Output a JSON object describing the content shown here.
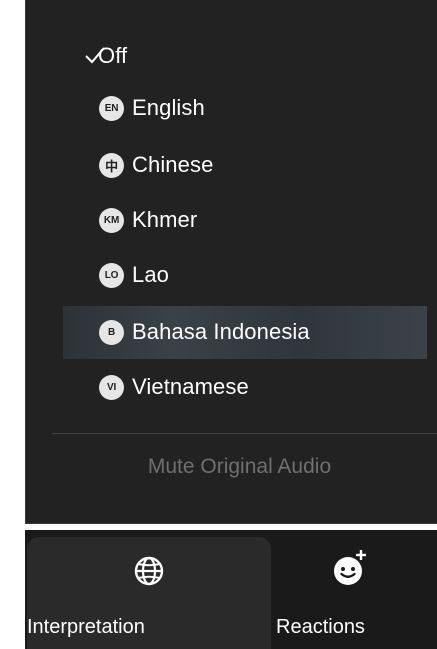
{
  "menu": {
    "selected_check": "✓",
    "items": [
      {
        "label": "Off",
        "badge": ""
      },
      {
        "label": "English",
        "badge": "EN"
      },
      {
        "label": "Chinese",
        "badge": "中"
      },
      {
        "label": "Khmer",
        "badge": "KM"
      },
      {
        "label": "Lao",
        "badge": "LO"
      },
      {
        "label": "Bahasa Indonesia",
        "badge": "B"
      },
      {
        "label": "Vietnamese",
        "badge": "VI"
      }
    ],
    "mute_original_audio": "Mute Original Audio"
  },
  "toolbar": {
    "interpretation_label": "Interpretation",
    "reactions_label": "Reactions",
    "interpretation_icon": "globe-icon",
    "reactions_icon": "add-emoji-icon"
  },
  "colors": {
    "menu_bg": "#222222",
    "toolbar_bg": "#1a1a1a",
    "badge_bg": "#e6e6e6",
    "disabled_text": "#6f6f6f"
  }
}
